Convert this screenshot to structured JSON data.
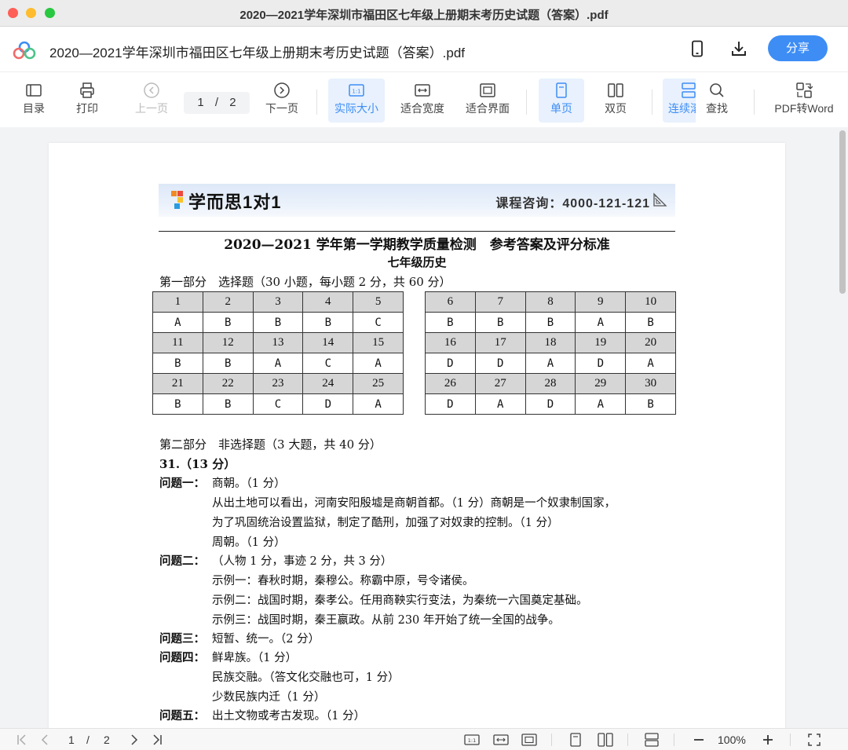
{
  "window": {
    "title": "2020—2021学年深圳市福田区七年级上册期末考历史试题（答案）.pdf"
  },
  "header": {
    "doc_title": "2020—2021学年深圳市福田区七年级上册期末考历史试题（答案）.pdf",
    "share_label": "分享"
  },
  "toolbar": {
    "toc": "目录",
    "print": "打印",
    "prev": "上一页",
    "page_current": "1",
    "page_sep": "/",
    "page_total": "2",
    "next": "下一页",
    "actual_size": "实际大小",
    "fit_width": "适合宽度",
    "fit_page": "适合界面",
    "single": "单页",
    "double": "双页",
    "continuous": "连续滚",
    "find": "查找",
    "to_word": "PDF转Word"
  },
  "document": {
    "brand": "学而思1对1",
    "consult": "课程咨询：4000-121-121",
    "title": "2020—2021 学年第一学期教学质量检测　参考答案及评分标准",
    "subtitle": "七年级历史",
    "part1": "第一部分　选择题（30 小题，每小题 2 分，共 60 分）",
    "table_left": [
      [
        "1",
        "2",
        "3",
        "4",
        "5"
      ],
      [
        "A",
        "B",
        "B",
        "B",
        "C"
      ],
      [
        "11",
        "12",
        "13",
        "14",
        "15"
      ],
      [
        "B",
        "B",
        "A",
        "C",
        "A"
      ],
      [
        "21",
        "22",
        "23",
        "24",
        "25"
      ],
      [
        "B",
        "B",
        "C",
        "D",
        "A"
      ]
    ],
    "table_right": [
      [
        "6",
        "7",
        "8",
        "9",
        "10"
      ],
      [
        "B",
        "B",
        "B",
        "A",
        "B"
      ],
      [
        "16",
        "17",
        "18",
        "19",
        "20"
      ],
      [
        "D",
        "D",
        "A",
        "D",
        "A"
      ],
      [
        "26",
        "27",
        "28",
        "29",
        "30"
      ],
      [
        "D",
        "A",
        "D",
        "A",
        "B"
      ]
    ],
    "part2": "第二部分　非选择题（3 大题，共 40 分）",
    "q31": "31.（13 分）",
    "q1_label": "问题一：",
    "q1_a": "商朝。（1 分）",
    "q1_b": "从出土地可以看出，河南安阳殷墟是商朝首都。（1 分）商朝是一个奴隶制国家，",
    "q1_c": "为了巩固统治设置监狱，制定了酷刑，加强了对奴隶的控制。（1 分）",
    "q1_d": "周朝。（1 分）",
    "q2_label": "问题二：",
    "q2_a": "（人物 1 分，事迹 2 分，共 3 分）",
    "q2_b": "示例一：春秋时期，秦穆公。称霸中原，号令诸侯。",
    "q2_c": "示例二：战国时期，秦孝公。任用商鞅实行变法，为秦统一六国奠定基础。",
    "q2_d": "示例三：战国时期，秦王嬴政。从前 230 年开始了统一全国的战争。",
    "q3_label": "问题三：",
    "q3_a": "短暂、统一。（2 分）",
    "q4_label": "问题四：",
    "q4_a": "鲜卑族。（1 分）",
    "q4_b": "民族交融。（答文化交融也可，1 分）",
    "q4_c": "少数民族内迁（1 分）",
    "q5_label": "问题五：",
    "q5_a": "出土文物或考古发现。（1 分）"
  },
  "bottombar": {
    "page_current": "1",
    "page_sep": "/",
    "page_total": "2",
    "zoom": "100%"
  },
  "colors": {
    "accent": "#3d8df5",
    "active_bg": "#e8f1fd",
    "table_header_bg": "#d6d6d6"
  },
  "icons": [
    "app-logo-icon",
    "phone-icon",
    "download-icon",
    "toc-icon",
    "print-icon",
    "prev-page-icon",
    "next-page-icon",
    "actual-size-icon",
    "fit-width-icon",
    "fit-page-icon",
    "single-page-icon",
    "double-page-icon",
    "continuous-icon",
    "search-icon",
    "pdf-to-word-icon"
  ]
}
